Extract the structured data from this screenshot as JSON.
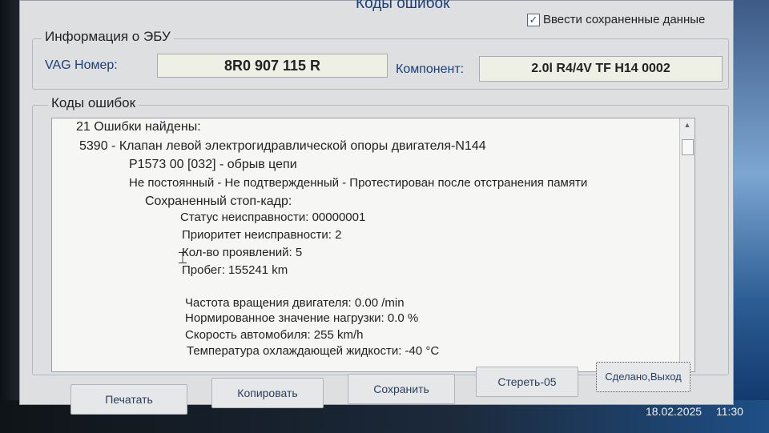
{
  "window": {
    "title": "Коды ошибок",
    "save_data_checkbox": {
      "label": "Ввести сохраненные данные",
      "checked": true
    }
  },
  "ecu_info": {
    "legend": "Информация о ЭБУ",
    "vag_label": "VAG Номер:",
    "vag_value": "8R0 907 115 R",
    "component_label": "Компонент:",
    "component_value": "2.0l R4/4V TF H14 0002"
  },
  "fault_codes": {
    "legend": "Коды ошибок",
    "lines": [
      "21 Ошибки найдены:",
      "5390 - Клапан левой электрогидравлической опоры двигателя-N144",
      "P1573 00 [032] - обрыв цепи",
      "Не постоянный - Не подтвержденный - Протестирован после отстранения памяти",
      "Сохраненный стоп-кадр:",
      "Статус неисправности: 00000001",
      "Приоритет неисправности: 2",
      "Кол-во проявлений: 5",
      "Пробег: 155241 km",
      "Частота вращения двигателя: 0.00 /min",
      "Нормированное значение нагрузки: 0.0 %",
      "Скорость автомобиля: 255 km/h",
      "Температура охлаждающей жидкости: -40 °C"
    ]
  },
  "buttons": {
    "print": "Печатать",
    "copy": "Копировать",
    "save": "Сохранить",
    "clear": "Стереть-05",
    "done": "Сделано,Выход"
  },
  "taskbar": {
    "date": "18.02.2025",
    "time": "11:30"
  },
  "icons": {
    "checkbox": "checkmark-icon",
    "scroll_up": "scroll-up-arrow-icon",
    "scroll_down": "scroll-down-arrow-icon",
    "cursor": "text-cursor-icon"
  }
}
